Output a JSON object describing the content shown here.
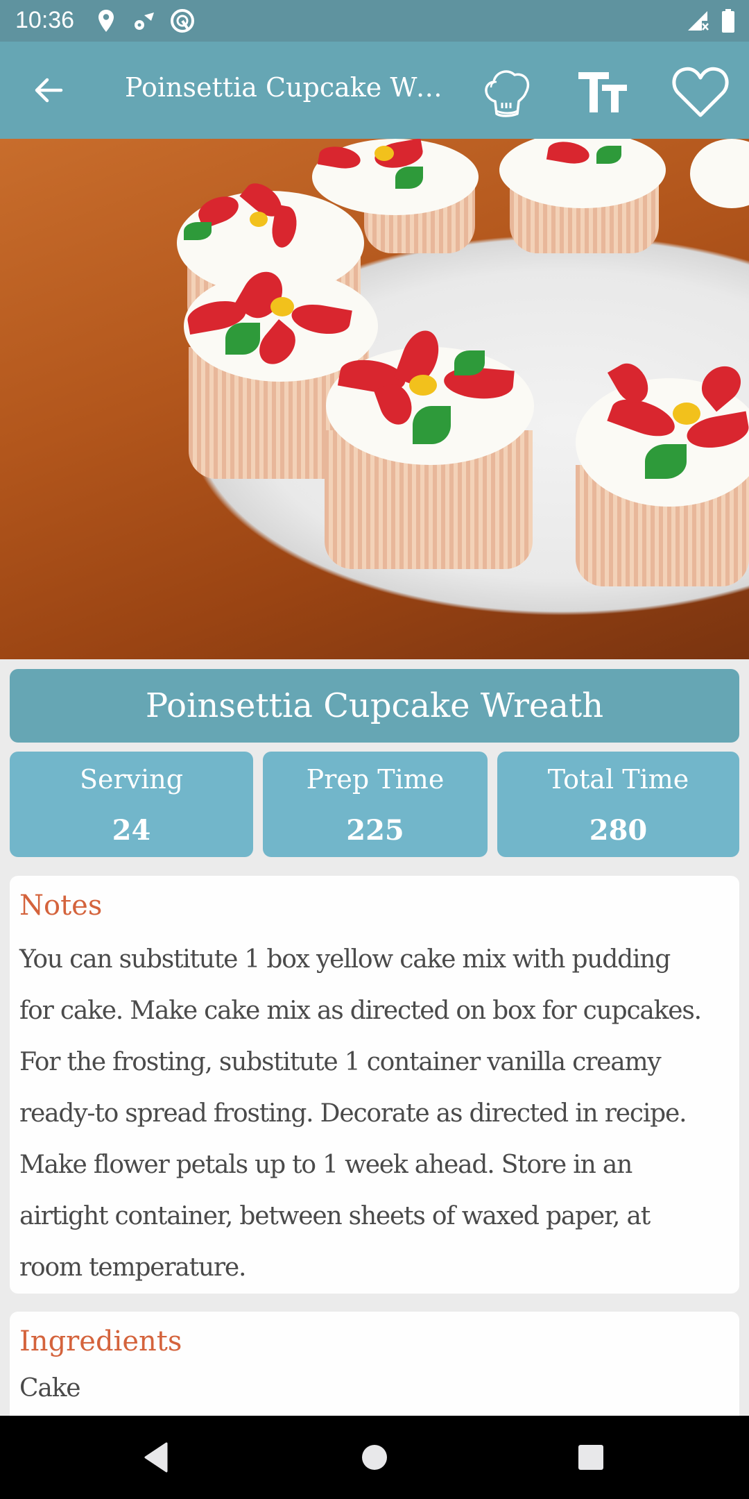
{
  "status_bar": {
    "time": "10:36",
    "left_icons": [
      "location-pin-icon",
      "settings-signal-icon",
      "data-saver-icon"
    ],
    "right_icons": [
      "cellular-no-signal-icon",
      "battery-icon"
    ]
  },
  "app_bar": {
    "back_icon": "arrow-back-icon",
    "title": "Poinsettia Cupcake Wreath",
    "actions": [
      {
        "name": "chef-hat-icon",
        "label": "Chef mode"
      },
      {
        "name": "text-size-icon",
        "label": "Text size"
      },
      {
        "name": "favorite-heart-icon",
        "label": "Favorite"
      }
    ]
  },
  "hero_image": {
    "alt": "Poinsettia cupcakes decorated with red and green flowers on a white plate"
  },
  "recipe": {
    "title": "Poinsettia Cupcake Wreath",
    "stats": [
      {
        "label": "Serving",
        "value": "24"
      },
      {
        "label": "Prep Time",
        "value": "225"
      },
      {
        "label": "Total Time",
        "value": "280"
      }
    ]
  },
  "notes": {
    "heading": "Notes",
    "lines": [
      "You can substitute 1 box yellow cake mix with pudding",
      "for cake. Make cake mix as directed on box for cupcakes.",
      "For the frosting, substitute 1 container vanilla creamy",
      "ready-to spread frosting. Decorate as directed in recipe.",
      "Make flower petals up to 1 week ahead. Store in an",
      "airtight container, between sheets of waxed paper, at",
      "room temperature."
    ]
  },
  "ingredients": {
    "heading": "Ingredients",
    "first_group": "Cake"
  },
  "nav_bar": {
    "buttons": [
      "back-triangle-icon",
      "home-circle-icon",
      "recents-square-icon"
    ]
  },
  "colors": {
    "status_bar": "#5f939f",
    "app_bar": "#66a6b4",
    "stat_card": "#72b6ca",
    "heading_accent": "#d4633c",
    "body_text": "#4a4a4a",
    "background": "#ebebeb"
  }
}
